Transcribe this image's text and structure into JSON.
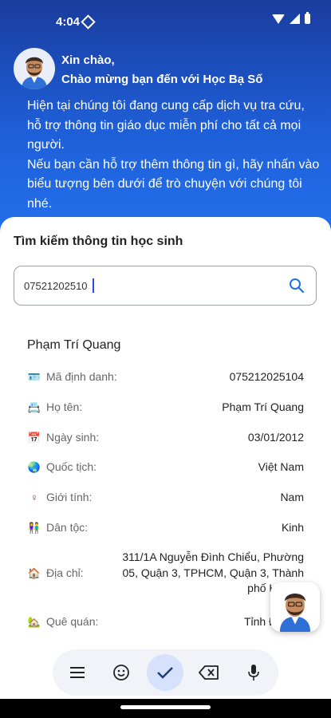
{
  "status_bar": {
    "time": "4:04"
  },
  "header": {
    "greeting_line1": "Xin chào,",
    "greeting_line2": "Chào mừng bạn đến với Học Bạ Số",
    "intro_para1": "Hiện tại chúng tôi đang cung cấp dịch vụ tra cứu, hỗ trợ thông tin giáo dục miễn phí cho tất cả mọi người.",
    "intro_para2": "Nếu bạn cần hỗ trợ thêm thông tin gì, hãy nhấn vào biểu tượng bên dưới để trò chuyện với chúng tôi nhé."
  },
  "search": {
    "title": "Tìm kiếm thông tin học sinh",
    "value": "07521202510"
  },
  "student": {
    "name": "Phạm Trí Quang",
    "fields": [
      {
        "icon": "🪪",
        "label": "Mã định danh:",
        "value": "075212025104"
      },
      {
        "icon": "📇",
        "label": "Họ tên:",
        "value": "Phạm Trí Quang"
      },
      {
        "icon": "📅",
        "label": "Ngày sinh:",
        "value": "03/01/2012"
      },
      {
        "icon": "🌏",
        "label": "Quốc tịch:",
        "value": "Việt Nam"
      },
      {
        "icon": "♀",
        "label": "Giới tính:",
        "value": "Nam"
      },
      {
        "icon": "👫",
        "label": "Dân tộc:",
        "value": "Kinh"
      }
    ],
    "address": {
      "icon": "🏠",
      "label": "Địa chỉ:",
      "value": "311/1A Nguyễn Đình Chiểu, Phường 05, Quận 3, TPHCM, Quận 3, Thành phố Hồ Chí"
    },
    "hometown": {
      "icon": "🏡",
      "label": "Quê quán:",
      "value": "Tỉnh Đồ"
    }
  },
  "keyboard": {
    "keys": [
      "menu-icon",
      "emoji-icon",
      "check-icon",
      "backspace-icon",
      "microphone-icon"
    ]
  },
  "colors": {
    "accent": "#1e5fd8",
    "header_dark": "#1a3c9e",
    "caret": "#2d4be0"
  }
}
